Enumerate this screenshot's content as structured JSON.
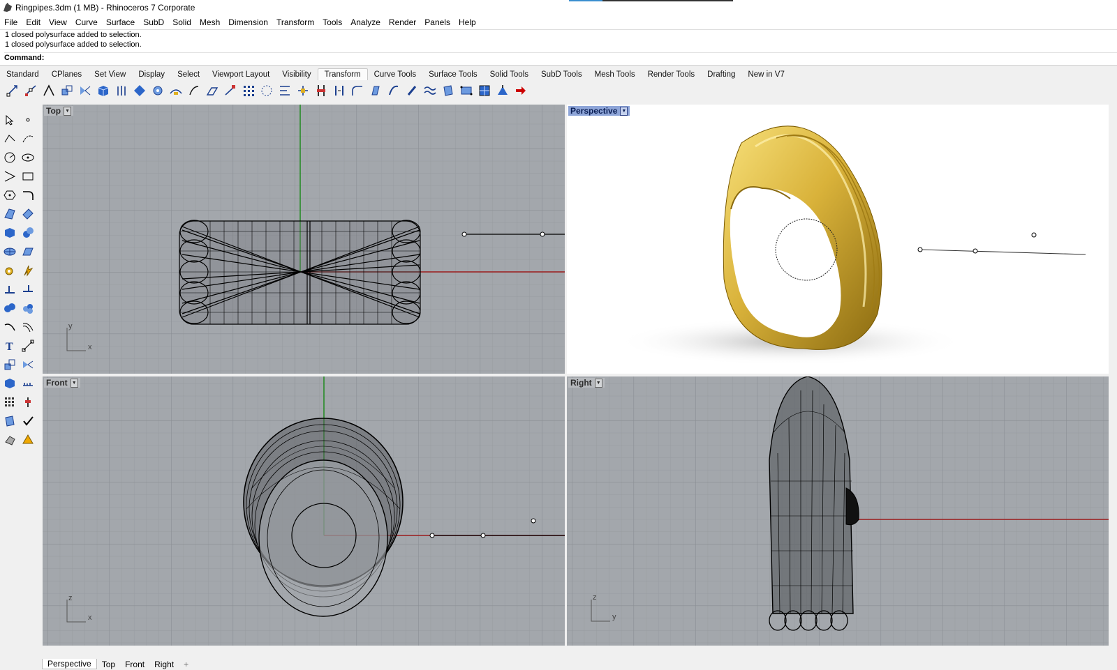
{
  "window": {
    "title": "Ringpipes.3dm (1 MB) - Rhinoceros 7 Corporate"
  },
  "menu": [
    "File",
    "Edit",
    "View",
    "Curve",
    "Surface",
    "SubD",
    "Solid",
    "Mesh",
    "Dimension",
    "Transform",
    "Tools",
    "Analyze",
    "Render",
    "Panels",
    "Help"
  ],
  "command": {
    "history": [
      "1 closed polysurface added to selection.",
      "1 closed polysurface added to selection."
    ],
    "prompt_label": "Command:",
    "prompt_value": ""
  },
  "toolbar_tabs": [
    "Standard",
    "CPlanes",
    "Set View",
    "Display",
    "Select",
    "Viewport Layout",
    "Visibility",
    "Transform",
    "Curve Tools",
    "Surface Tools",
    "Solid Tools",
    "SubD Tools",
    "Mesh Tools",
    "Render Tools",
    "Drafting",
    "New in V7"
  ],
  "active_tab": "Transform",
  "viewports": {
    "top": {
      "label": "Top",
      "axis_labels": [
        "y",
        "x"
      ]
    },
    "perspective": {
      "label": "Perspective",
      "active": true
    },
    "front": {
      "label": "Front",
      "axis_labels": [
        "z",
        "x"
      ]
    },
    "right": {
      "label": "Right",
      "axis_labels": [
        "z",
        "y"
      ]
    }
  },
  "viewport_tabs": [
    "Perspective",
    "Top",
    "Front",
    "Right"
  ],
  "viewport_tab_add": "+",
  "colors": {
    "grid_bg": "#a3a7ac",
    "x_axis": "#9b1c1c",
    "y_axis": "#1f8a1f",
    "ring_gold": "#d9b23a",
    "active_label": "#8ea5d8"
  }
}
